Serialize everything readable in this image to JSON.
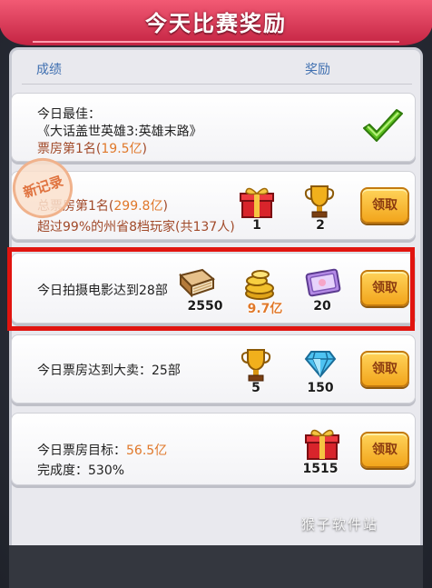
{
  "header": {
    "title": "今天比赛奖励"
  },
  "columns": {
    "left": "成绩",
    "right": "奖励"
  },
  "rows": [
    {
      "line1": "今日最佳：",
      "line2": "《大话盖世英雄3:英雄末路》",
      "line3_prefix": "票房第1名(",
      "line3_value": "19.5亿",
      "line3_suffix": ")",
      "status": "completed"
    },
    {
      "stamp": "新记录",
      "line1_prefix": "总票房第1名(",
      "line1_value": "299.8亿",
      "line1_suffix": ")",
      "line2": "超过99%的州省8档玩家(共137人)",
      "rewards": [
        {
          "icon": "gift-box-icon",
          "count": "1"
        },
        {
          "icon": "trophy-icon",
          "count": "2"
        }
      ],
      "button": "领取"
    },
    {
      "line1": "今日拍摄电影达到28部",
      "rewards": [
        {
          "icon": "book-icon",
          "count": "2550"
        },
        {
          "icon": "gold-coins-icon",
          "count": "9.7亿"
        },
        {
          "icon": "ticket-icon",
          "count": "20"
        }
      ],
      "button": "领取"
    },
    {
      "line1": "今日票房达到大卖：25部",
      "rewards": [
        {
          "icon": "trophy-icon",
          "count": "5"
        },
        {
          "icon": "diamond-icon",
          "count": "150"
        }
      ],
      "button": "领取"
    },
    {
      "line1_prefix": "今日票房目标：",
      "line1_value": "56.5亿",
      "line2": "完成度：530%",
      "rewards": [
        {
          "icon": "gift-box-icon",
          "count": "1515"
        }
      ],
      "button": "领取"
    }
  ],
  "watermark": "猴子软件站",
  "colors": {
    "accent_red": "#d9324f",
    "button_gold": "#f2a51c",
    "value_orange": "#e0782a"
  }
}
